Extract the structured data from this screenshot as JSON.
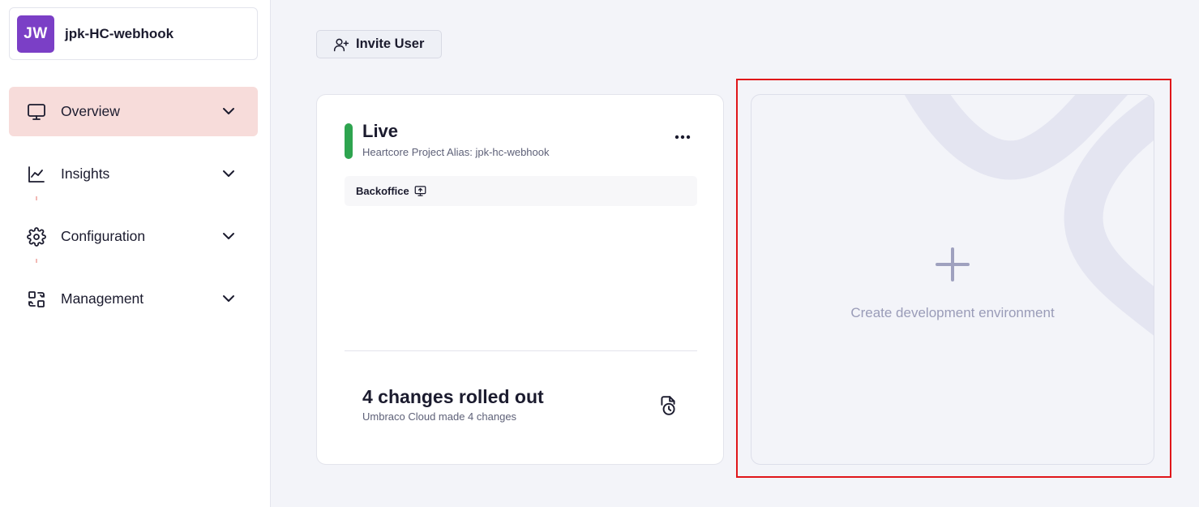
{
  "project": {
    "avatar_initials": "JW",
    "name": "jpk-HC-webhook",
    "avatar_color": "#7b3fc6"
  },
  "sidebar": {
    "items": [
      {
        "label": "Overview",
        "icon": "monitor-icon",
        "active": true
      },
      {
        "label": "Insights",
        "icon": "chart-icon",
        "active": false
      },
      {
        "label": "Configuration",
        "icon": "gear-icon",
        "active": false
      },
      {
        "label": "Management",
        "icon": "management-icon",
        "active": false
      }
    ]
  },
  "toolbar": {
    "invite_label": "Invite User",
    "invite_icon": "user-plus-icon"
  },
  "environment": {
    "title": "Live",
    "alias": "Heartcore Project Alias: jpk-hc-webhook",
    "status_color": "#2ea44f",
    "backoffice_label": "Backoffice",
    "changes_title": "4 changes rolled out",
    "changes_sub": "Umbraco Cloud made 4 changes"
  },
  "create": {
    "label": "Create development environment",
    "icon": "plus-icon"
  },
  "colors": {
    "active_nav": "#f7dcda",
    "highlight": "#e0161a"
  }
}
